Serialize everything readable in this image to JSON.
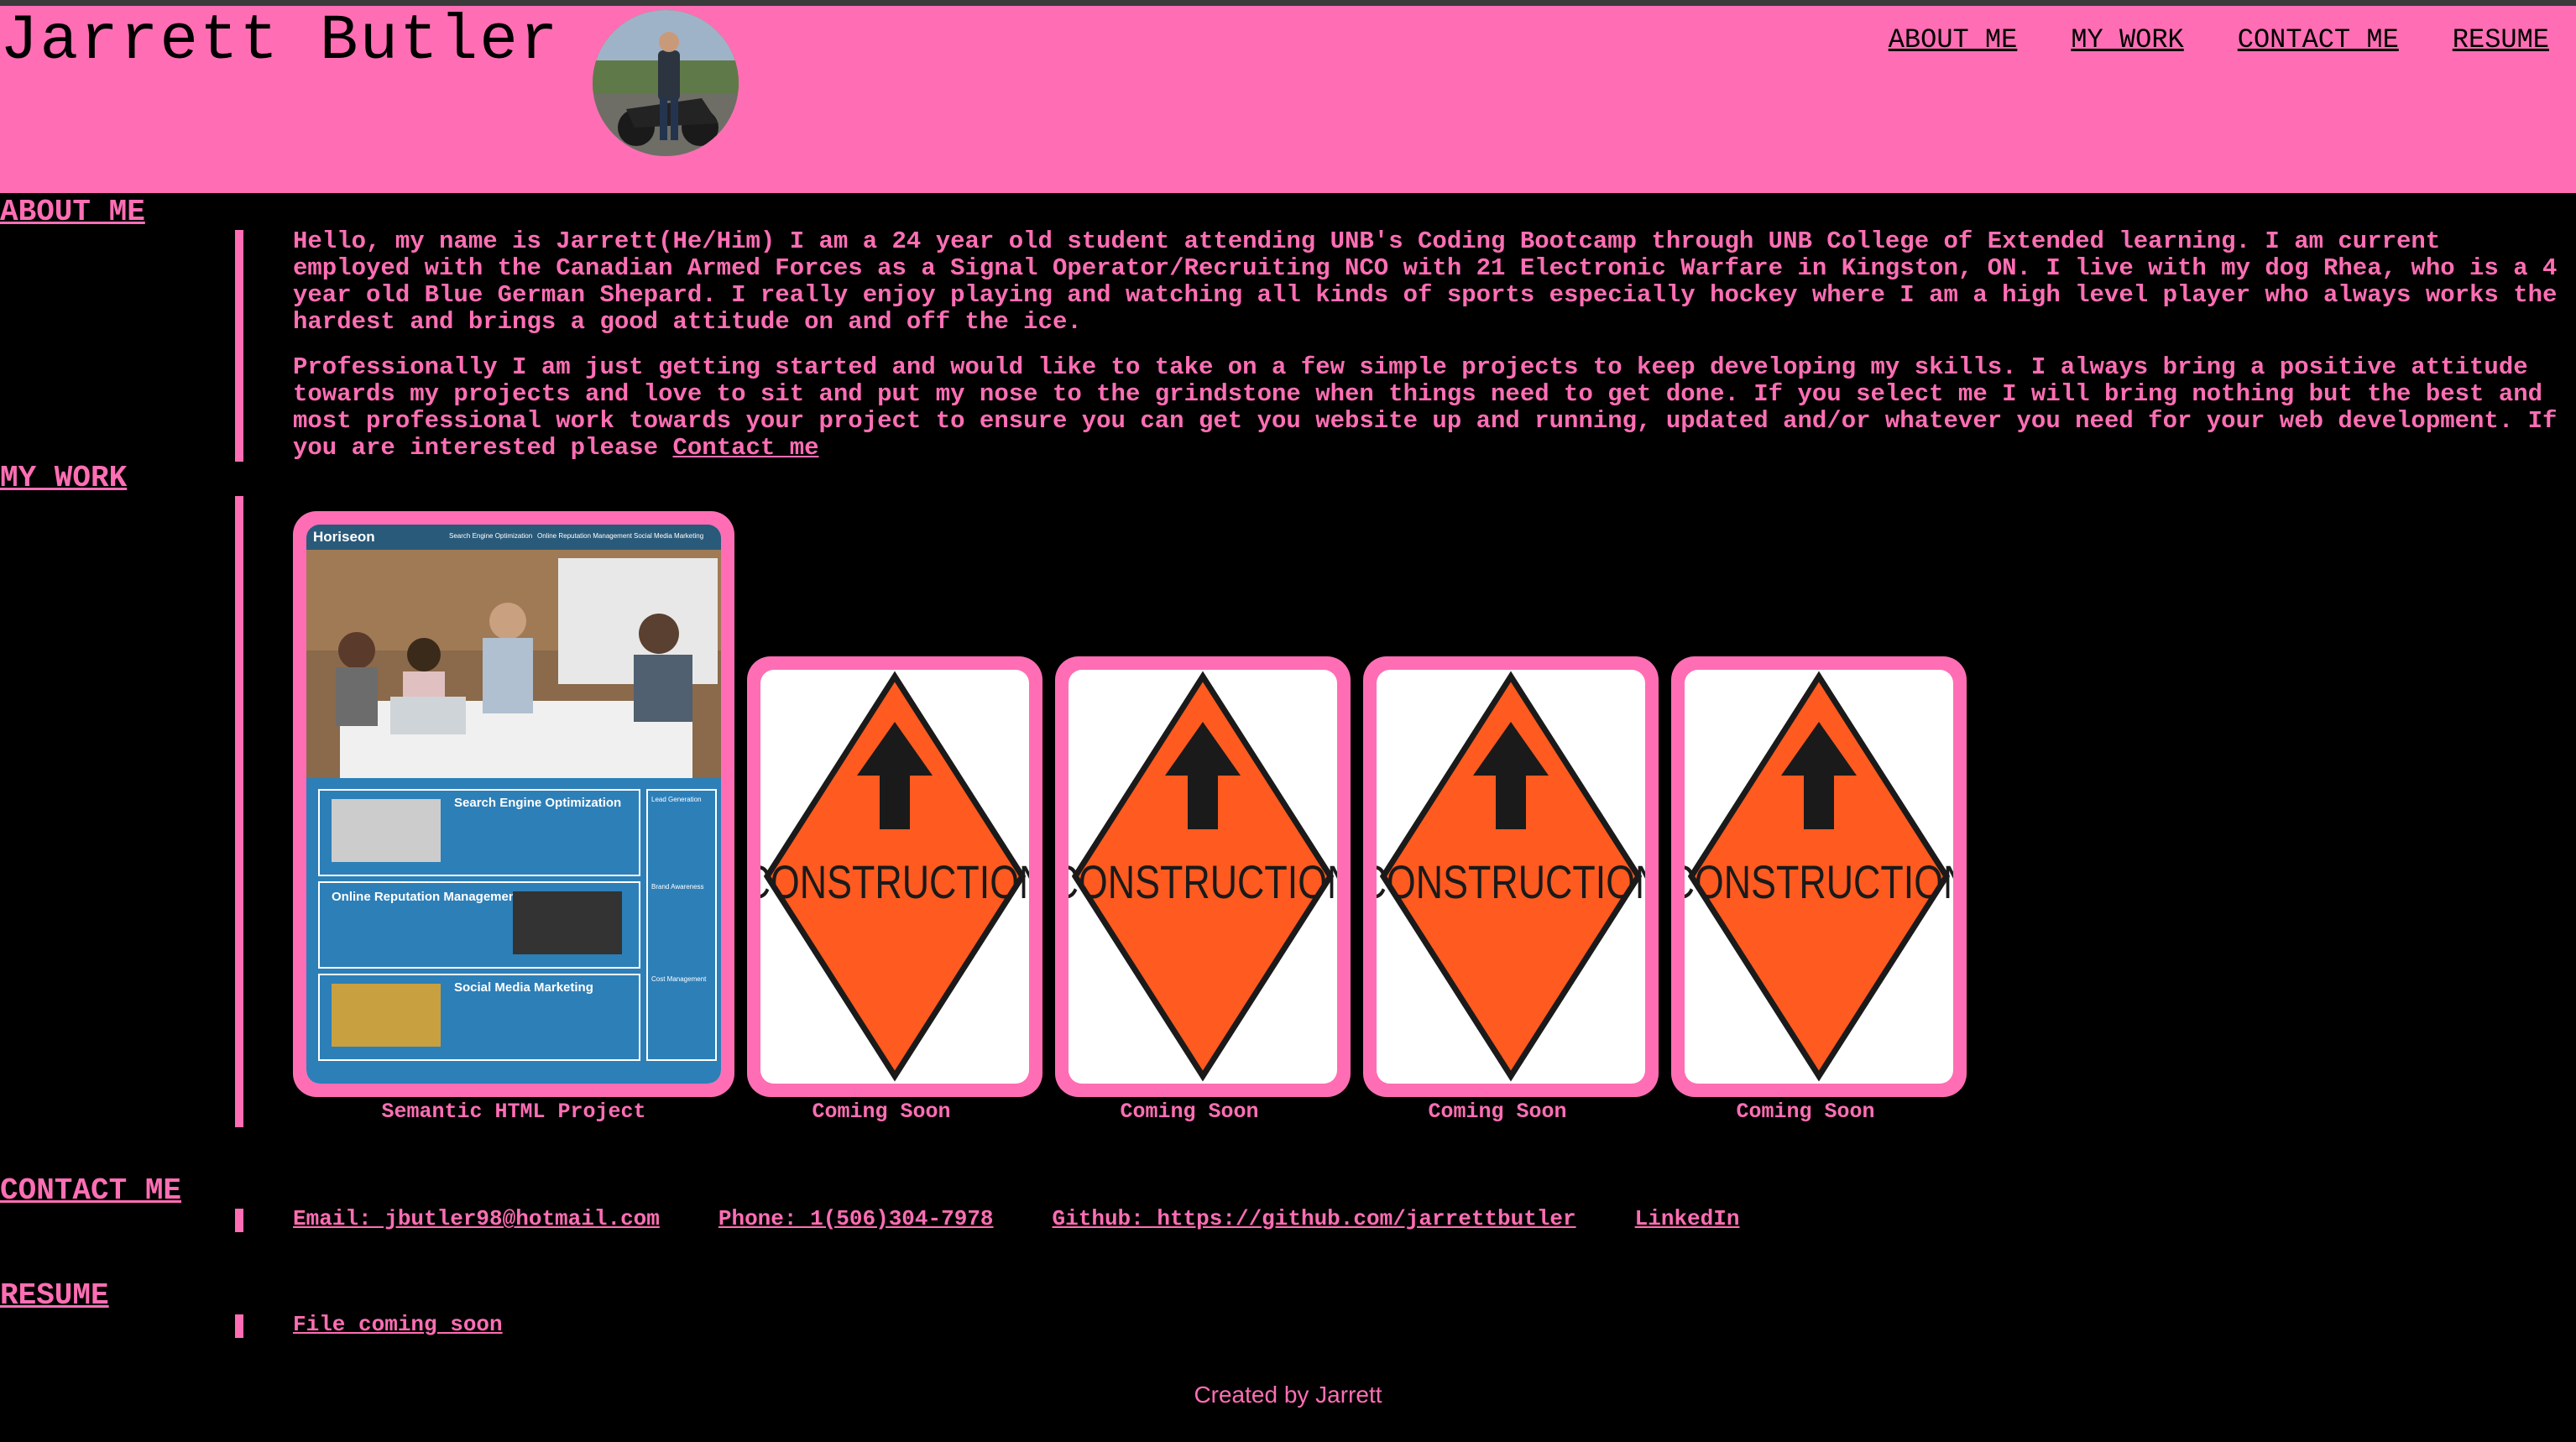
{
  "header": {
    "name": "Jarrett Butler",
    "nav": [
      "ABOUT ME",
      "MY WORK",
      "CONTACT ME",
      "RESUME"
    ]
  },
  "about": {
    "title": "ABOUT ME",
    "paragraph1": "Hello, my name is Jarrett(He/Him) I am a 24 year old student attending UNB's Coding Bootcamp through UNB College of Extended learning. I am current employed with the Canadian Armed Forces as a Signal Operator/Recruiting NCO with 21 Electronic Warfare in Kingston, ON. I live with my dog Rhea, who is a 4 year old Blue German Shepard. I really enjoy playing and watching all kinds of sports especially hockey where I am a high level player who always works the hardest and brings a good attitude on and off the ice.",
    "paragraph2": "Professionally I am just getting started and would like to take on a few simple projects to keep developing my skills. I always bring a positive attitude towards my projects and love to sit and put my nose to the grindstone when things need to get done. If you select me I will bring nothing but the best and most professional work towards your project to ensure you can get you website up and running, updated and/or whatever you need for your web development. If you are interested please",
    "contact_link": "Contact me"
  },
  "work": {
    "title": "MY WORK",
    "projects": [
      {
        "caption": "Semantic HTML Project"
      },
      {
        "caption": "Coming Soon",
        "sign_text": "CONSTRUCTION"
      },
      {
        "caption": "Coming Soon",
        "sign_text": "CONSTRUCTION"
      },
      {
        "caption": "Coming Soon",
        "sign_text": "CONSTRUCTION"
      },
      {
        "caption": "Coming Soon",
        "sign_text": "CONSTRUCTION"
      }
    ],
    "mock_site": {
      "brand": "Horiseon",
      "nav": [
        "Search Engine Optimization",
        "Online Reputation Management",
        "Social Media Marketing"
      ],
      "sections": [
        "Search Engine Optimization",
        "Online Reputation Management",
        "Social Media Marketing"
      ],
      "side": [
        "Lead Generation",
        "Brand Awareness",
        "Cost Management"
      ]
    }
  },
  "contact": {
    "title": "CONTACT ME",
    "links": [
      "Email: jbutler98@hotmail.com",
      "Phone: 1(506)304-7978",
      "Github: https://github.com/jarrettbutler",
      "LinkedIn"
    ]
  },
  "resume": {
    "title": "RESUME",
    "link": "File coming soon"
  },
  "footer": "Created by Jarrett",
  "colors": {
    "accent": "#ff6eb4",
    "background": "#000000",
    "sign": "#ff5a1f"
  }
}
